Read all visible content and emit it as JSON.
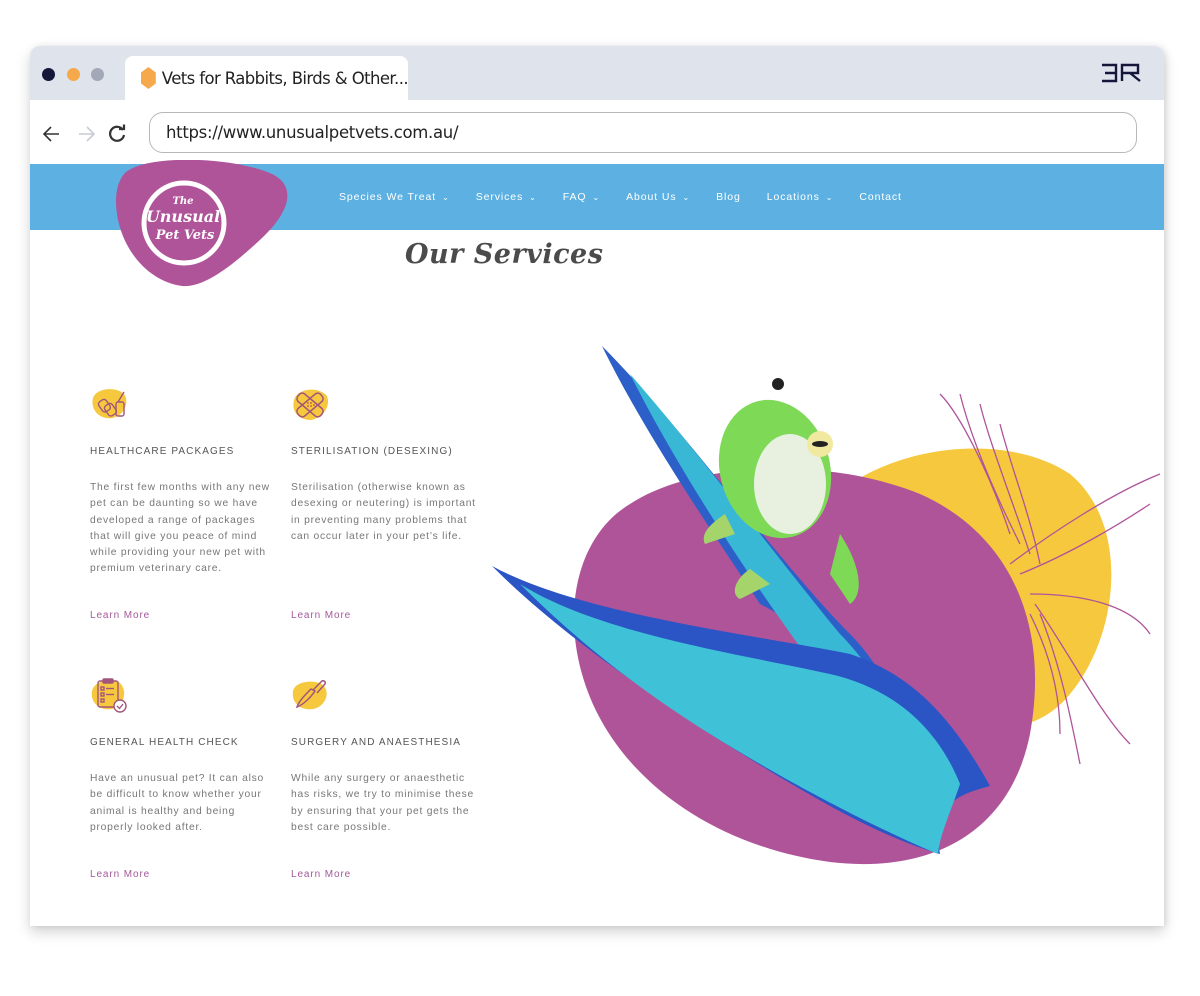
{
  "browser": {
    "tab_title": "Vets for Rabbits, Birds & Other...",
    "url": "https://www.unusualpetvets.com.au/",
    "brand_mark": "3R",
    "traffic_lights": [
      "#14163a",
      "#f5a94a",
      "#a3a8b8"
    ]
  },
  "site": {
    "logo": {
      "line1": "The",
      "line2": "Unusual",
      "line3": "Pet Vets"
    },
    "nav": [
      {
        "label": "Species We Treat",
        "has_dropdown": true
      },
      {
        "label": "Services",
        "has_dropdown": true
      },
      {
        "label": "FAQ",
        "has_dropdown": true
      },
      {
        "label": "About Us",
        "has_dropdown": true
      },
      {
        "label": "Blog",
        "has_dropdown": false
      },
      {
        "label": "Locations",
        "has_dropdown": true
      },
      {
        "label": "Contact",
        "has_dropdown": false
      }
    ],
    "section_title": "Our Services",
    "services": [
      {
        "icon": "medicine-package-icon",
        "title": "HEALTHCARE PACKAGES",
        "description": "The first few months with any new pet can be daunting so we have developed a range of packages that will give you peace of mind while providing your new pet with premium veterinary care.",
        "link": "Learn More"
      },
      {
        "icon": "bandage-icon",
        "title": "STERILISATION (DESEXING)",
        "description": "Sterilisation (otherwise known as desexing or neutering) is important in preventing many problems that can occur later in your pet’s life.",
        "link": "Learn More"
      },
      {
        "icon": "clipboard-check-icon",
        "title": "GENERAL HEALTH CHECK",
        "description": "Have an unusual pet? It can also be difficult to know whether your animal is healthy and being properly looked after.",
        "link": "Learn More"
      },
      {
        "icon": "scalpel-icon",
        "title": "SURGERY AND ANAESTHESIA",
        "description": "While any surgery or anaesthetic has risks, we try to minimise these by ensuring that your pet gets the best care possible.",
        "link": "Learn More"
      }
    ],
    "colors": {
      "nav_blue": "#5db1e2",
      "brand_purple": "#b05499",
      "accent_yellow": "#f6c83e",
      "link_purple": "#a35a9a"
    }
  }
}
